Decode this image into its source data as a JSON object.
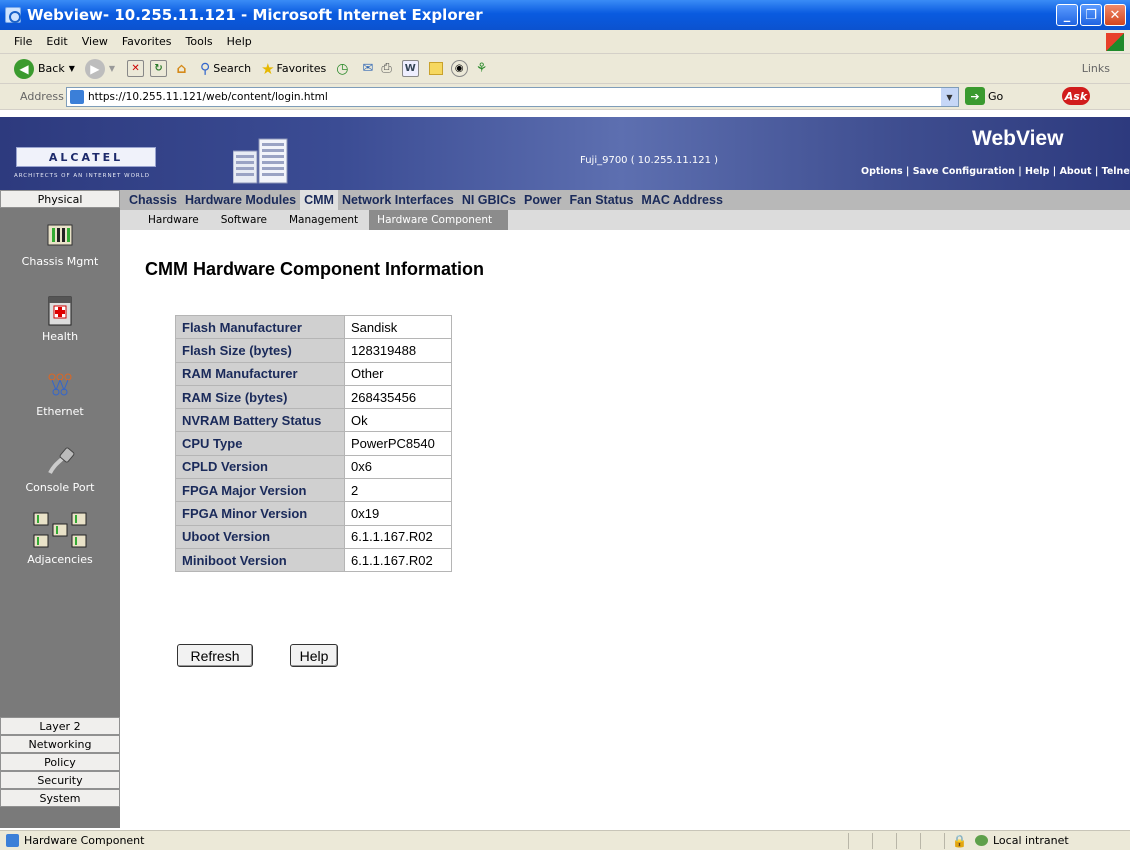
{
  "window": {
    "title": "Webview- 10.255.11.121 - Microsoft Internet Explorer"
  },
  "menu": [
    "File",
    "Edit",
    "View",
    "Favorites",
    "Tools",
    "Help"
  ],
  "toolbar": {
    "back": "Back",
    "search": "Search",
    "favorites": "Favorites",
    "links": "Links"
  },
  "address": {
    "label": "Address",
    "url": "https://10.255.11.121/web/content/login.html",
    "go": "Go",
    "ask": "Ask"
  },
  "banner": {
    "logo": "ALCATEL",
    "tagline": "ARCHITECTS OF AN INTERNET WORLD",
    "device": "Fuji_9700  ( 10.255.11.121 )",
    "product": "WebView",
    "links": "Options |  Save Configuration | Help | About | Telnet | Log Ou"
  },
  "sidebar": {
    "top": "Physical",
    "items": [
      "Chassis Mgmt",
      "Health",
      "Ethernet",
      "Console Port",
      "Adjacencies"
    ],
    "bottom": [
      "Layer 2",
      "Networking",
      "Policy",
      "Security",
      "System"
    ]
  },
  "mainnav": {
    "items": [
      "Chassis",
      "Hardware Modules",
      "CMM",
      "Network Interfaces",
      "NI GBICs",
      "Power",
      "Fan Status",
      "MAC Address"
    ],
    "active": "CMM"
  },
  "subnav": {
    "items": [
      "Hardware",
      "Software",
      "Management",
      "Hardware Component"
    ],
    "active": "Hardware Component"
  },
  "page": {
    "title": "CMM Hardware Component Information",
    "rows": [
      {
        "label": "Flash Manufacturer",
        "value": "Sandisk"
      },
      {
        "label": "Flash Size (bytes)",
        "value": "128319488"
      },
      {
        "label": "RAM Manufacturer",
        "value": "Other"
      },
      {
        "label": "RAM Size (bytes)",
        "value": "268435456"
      },
      {
        "label": "NVRAM Battery Status",
        "value": "Ok"
      },
      {
        "label": "CPU Type",
        "value": "PowerPC8540"
      },
      {
        "label": "CPLD Version",
        "value": "0x6"
      },
      {
        "label": "FPGA Major Version",
        "value": "2"
      },
      {
        "label": "FPGA Minor Version",
        "value": "0x19"
      },
      {
        "label": "Uboot Version",
        "value": "6.1.1.167.R02"
      },
      {
        "label": "Miniboot Version",
        "value": "6.1.1.167.R02"
      }
    ],
    "refresh": "Refresh",
    "help": "Help"
  },
  "status": {
    "text": "Hardware Component",
    "zone": "Local intranet"
  }
}
